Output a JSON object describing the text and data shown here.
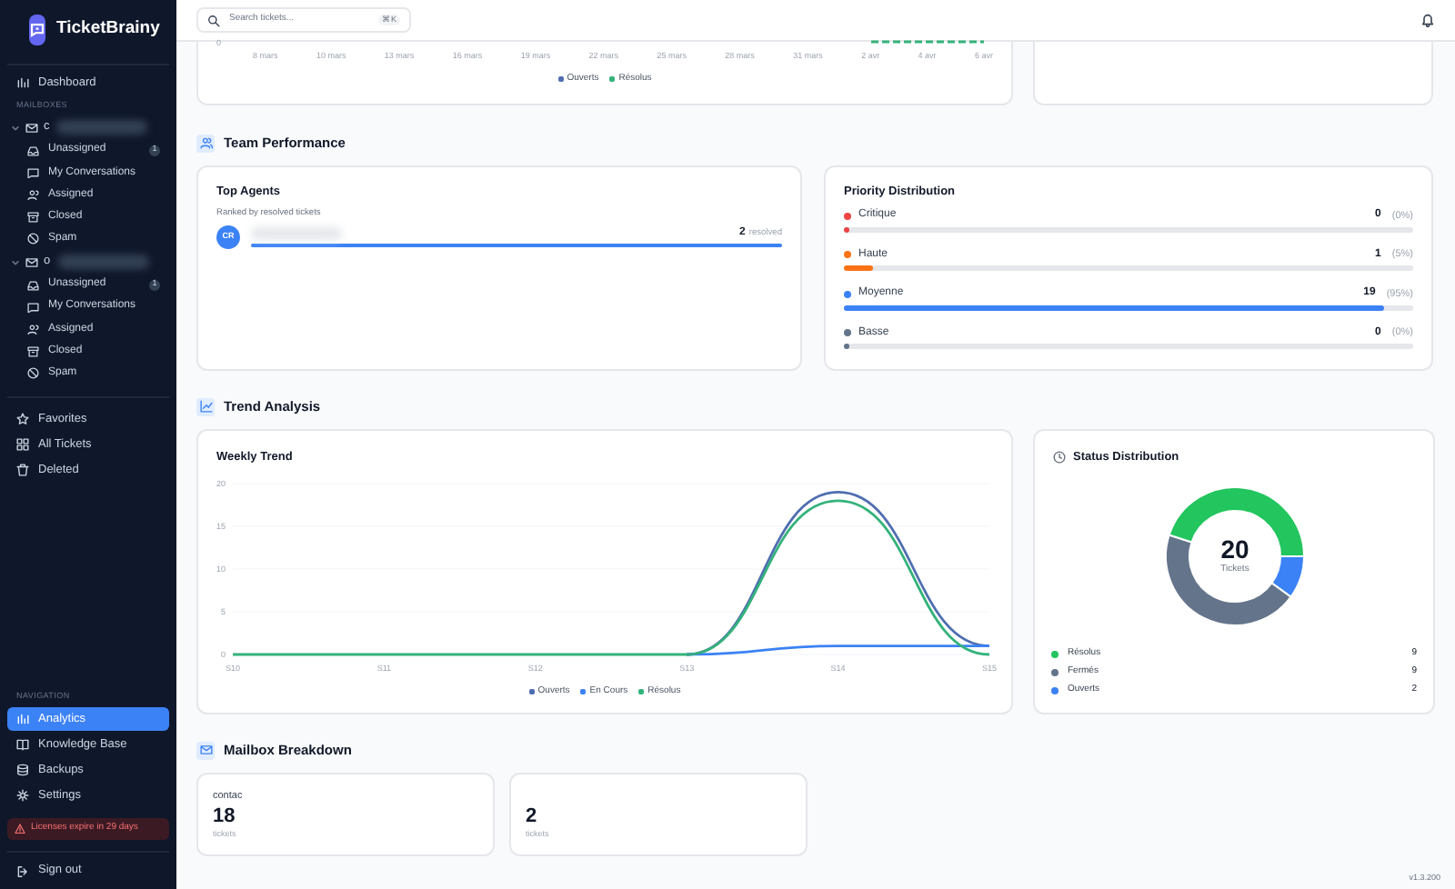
{
  "sidebar": {
    "brand": "TicketBrainy",
    "dashboard": {
      "label": "Dashboard",
      "selected": false
    },
    "mailboxes_heading": "MAILBOXES",
    "mailboxes": [
      {
        "name": "c",
        "expanded": true,
        "items": [
          {
            "label": "Unassigned",
            "count": "1"
          },
          {
            "label": "My Conversations"
          },
          {
            "label": "Assigned"
          },
          {
            "label": "Closed"
          },
          {
            "label": "Spam"
          }
        ]
      },
      {
        "name": "o",
        "expanded": true,
        "items": [
          {
            "label": "Unassigned",
            "count": "1"
          },
          {
            "label": "My Conversations"
          },
          {
            "label": "Assigned"
          },
          {
            "label": "Closed"
          },
          {
            "label": "Spam"
          }
        ]
      }
    ],
    "links": [
      {
        "label": "Favorites"
      },
      {
        "label": "All Tickets"
      },
      {
        "label": "Deleted"
      }
    ],
    "navigation_heading": "NAVIGATION",
    "navigation": [
      {
        "label": "Analytics",
        "selected": true
      },
      {
        "label": "Knowledge Base",
        "selected": false
      },
      {
        "label": "Backups",
        "selected": false
      },
      {
        "label": "Settings",
        "selected": false
      }
    ],
    "license_notice": "Licenses expire in 29 days",
    "sign_out": "Sign out"
  },
  "header": {
    "search": {
      "placeholder": "Search tickets...",
      "shortcut": "⌘K"
    }
  },
  "top_chart_fragment": {
    "y_tick": "0",
    "x_labels": [
      "8 mars",
      "10 mars",
      "13 mars",
      "16 mars",
      "19 mars",
      "22 mars",
      "25 mars",
      "28 mars",
      "31 mars",
      "2 avr",
      "4 avr",
      "6 avr"
    ],
    "legend": [
      {
        "label": "Ouverts",
        "color": "#4f6eb0"
      },
      {
        "label": "Résolus",
        "color": "#34b27b"
      }
    ]
  },
  "team_performance": {
    "title": "Team Performance",
    "top_agents": {
      "title": "Top Agents",
      "subtitle": "Ranked by resolved tickets",
      "agents": [
        {
          "initials": "CR",
          "count": "2",
          "unit": "resolved",
          "level": 1
        }
      ]
    },
    "priority_distribution": {
      "title": "Priority Distribution",
      "items": [
        {
          "label": "Critique",
          "count": "0",
          "percent": "(0%)",
          "color": "#ef4444",
          "level": 0
        },
        {
          "label": "Haute",
          "count": "1",
          "percent": "(5%)",
          "color": "#f97316",
          "level": 0.05
        },
        {
          "label": "Moyenne",
          "count": "19",
          "percent": "(95%)",
          "color": "#3b82f6",
          "level": 0.95
        },
        {
          "label": "Basse",
          "count": "0",
          "percent": "(0%)",
          "color": "#64748b",
          "level": 0
        }
      ]
    }
  },
  "trend_analysis": {
    "title": "Trend Analysis",
    "weekly_trend": {
      "title": "Weekly Trend",
      "chart_data": {
        "type": "line",
        "categories": [
          "S10",
          "S11",
          "S12",
          "S13",
          "S14",
          "S15"
        ],
        "series": [
          {
            "name": "Ouverts",
            "color": "#4f6eb0",
            "values": [
              null,
              null,
              null,
              0,
              19,
              1
            ]
          },
          {
            "name": "En Cours",
            "color": "#3b82f6",
            "values": [
              null,
              null,
              null,
              0,
              1,
              1
            ]
          },
          {
            "name": "Résolus",
            "color": "#34b27b",
            "values": [
              0,
              0,
              0,
              0,
              18,
              0
            ]
          }
        ],
        "ylim": [
          0,
          20
        ],
        "yticks": [
          0,
          5,
          10,
          15,
          20
        ],
        "grid": true
      }
    },
    "status_distribution": {
      "title": "Status Distribution",
      "center_value": "20",
      "center_label": "Tickets",
      "chart_data": {
        "type": "donut",
        "categories": [
          "Résolus",
          "Fermés",
          "Ouverts"
        ],
        "values": [
          45,
          45,
          10
        ]
      },
      "legend": [
        {
          "value": "9",
          "color": "#22c55e"
        },
        {
          "value": "9",
          "color": "#64748b"
        },
        {
          "value": "2",
          "color": "#3b82f6"
        }
      ]
    }
  },
  "mailbox_breakdown": {
    "title": "Mailbox Breakdown",
    "cards": [
      {
        "name": "contac",
        "count": "18",
        "unit": "tickets"
      },
      {
        "count": "2",
        "unit": "tickets"
      }
    ]
  },
  "version": "v1.3.200"
}
